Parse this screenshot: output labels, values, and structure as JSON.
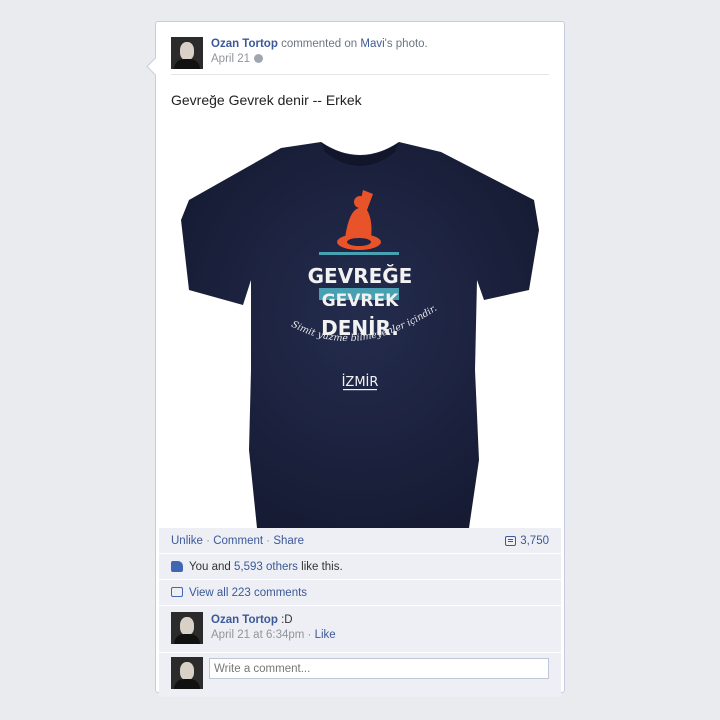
{
  "post": {
    "actor_name": "Ozan Tortop",
    "action_text": "commented on",
    "target_name": "Mavi",
    "target_suffix": "'s photo.",
    "date": "April 21",
    "text": "Gevreğe Gevrek denir -- Erkek"
  },
  "shirt_print": {
    "line1": "GEVREĞE",
    "line2": "GEVREK",
    "line3": "DENİR.",
    "script": "Simit yüzme bilmeyenler içindir.",
    "city": "İZMİR",
    "colors": {
      "shirt": "#1e2544",
      "accent": "#e8532a",
      "band": "#4aa0b3"
    }
  },
  "actions": {
    "unlike": "Unlike",
    "sep": "·",
    "comment": "Comment",
    "share": "Share",
    "comment_count": "3,750"
  },
  "likes": {
    "prefix": "You and",
    "others": "5,593 others",
    "suffix": "like this."
  },
  "view_all": "View all 223 comments",
  "comment": {
    "author": "Ozan Tortop",
    "text": ":D",
    "time": "April 21 at 6:34pm",
    "like": "Like"
  },
  "composer": {
    "placeholder": "Write a comment..."
  }
}
